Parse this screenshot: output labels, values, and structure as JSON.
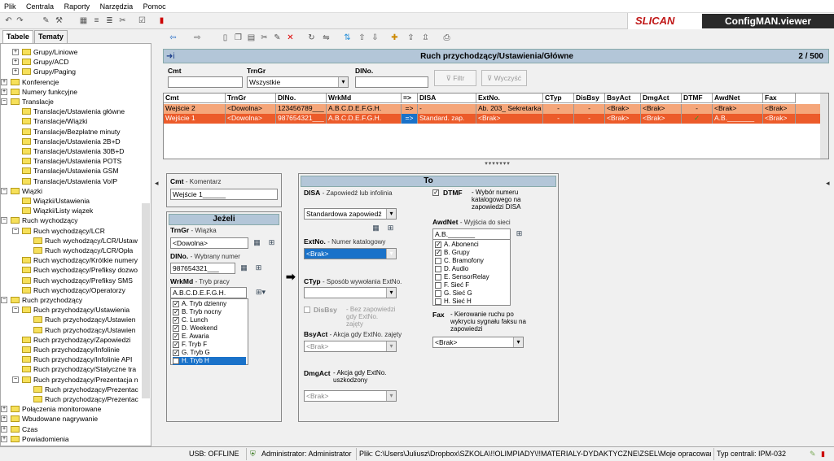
{
  "menu": [
    "Plik",
    "Centrala",
    "Raporty",
    "Narzędzia",
    "Pomoc"
  ],
  "brand": {
    "logo": "SLICAN",
    "app": "ConfigMAN.viewer"
  },
  "left_tabs": [
    "Tabele",
    "Tematy"
  ],
  "tree": [
    {
      "label": "Grupy/Liniowe",
      "level": 2,
      "pm": "+"
    },
    {
      "label": "Grupy/ACD",
      "level": 2,
      "pm": "+"
    },
    {
      "label": "Grupy/Paging",
      "level": 2,
      "pm": "+"
    },
    {
      "label": "Konferencje",
      "level": 1,
      "pm": "+"
    },
    {
      "label": "Numery funkcyjne",
      "level": 1,
      "pm": "+"
    },
    {
      "label": "Translacje",
      "level": 1,
      "pm": "-"
    },
    {
      "label": "Translacje/Ustawienia główne",
      "level": 2,
      "pm": ""
    },
    {
      "label": "Translacje/Wiązki",
      "level": 2,
      "pm": ""
    },
    {
      "label": "Translacje/Bezpłatne minuty",
      "level": 2,
      "pm": ""
    },
    {
      "label": "Translacje/Ustawienia 2B+D",
      "level": 2,
      "pm": ""
    },
    {
      "label": "Translacje/Ustawienia 30B+D",
      "level": 2,
      "pm": ""
    },
    {
      "label": "Translacje/Ustawienia POTS",
      "level": 2,
      "pm": ""
    },
    {
      "label": "Translacje/Ustawienia GSM",
      "level": 2,
      "pm": ""
    },
    {
      "label": "Translacje/Ustawienia VoIP",
      "level": 2,
      "pm": ""
    },
    {
      "label": "Wiązki",
      "level": 1,
      "pm": "-"
    },
    {
      "label": "Wiązki/Ustawienia",
      "level": 2,
      "pm": ""
    },
    {
      "label": "Wiązki/Listy wiązek",
      "level": 2,
      "pm": ""
    },
    {
      "label": "Ruch wychodzący",
      "level": 1,
      "pm": "-"
    },
    {
      "label": "Ruch wychodzący/LCR",
      "level": 2,
      "pm": "-"
    },
    {
      "label": "Ruch wychodzący/LCR/Ustaw",
      "level": 3,
      "pm": ""
    },
    {
      "label": "Ruch wychodzący/LCR/Opła",
      "level": 3,
      "pm": ""
    },
    {
      "label": "Ruch wychodzący/Krótkie numery",
      "level": 2,
      "pm": ""
    },
    {
      "label": "Ruch wychodzący/Prefiksy dozwo",
      "level": 2,
      "pm": ""
    },
    {
      "label": "Ruch wychodzący/Prefiksy SMS",
      "level": 2,
      "pm": ""
    },
    {
      "label": "Ruch wychodzący/Operatorzy",
      "level": 2,
      "pm": ""
    },
    {
      "label": "Ruch przychodzący",
      "level": 1,
      "pm": "-"
    },
    {
      "label": "Ruch przychodzący/Ustawienia",
      "level": 2,
      "pm": "-"
    },
    {
      "label": "Ruch przychodzący/Ustawien",
      "level": 3,
      "pm": ""
    },
    {
      "label": "Ruch przychodzący/Ustawien",
      "level": 3,
      "pm": ""
    },
    {
      "label": "Ruch przychodzący/Zapowiedzi",
      "level": 2,
      "pm": ""
    },
    {
      "label": "Ruch przychodzący/Infolinie",
      "level": 2,
      "pm": ""
    },
    {
      "label": "Ruch przychodzący/Infolinie API",
      "level": 2,
      "pm": ""
    },
    {
      "label": "Ruch przychodzący/Statyczne tra",
      "level": 2,
      "pm": ""
    },
    {
      "label": "Ruch przychodzący/Prezentacja n",
      "level": 2,
      "pm": "-"
    },
    {
      "label": "Ruch przychodzący/Prezentac",
      "level": 3,
      "pm": ""
    },
    {
      "label": "Ruch przychodzący/Prezentac",
      "level": 3,
      "pm": ""
    },
    {
      "label": "Połączenia monitorowane",
      "level": 1,
      "pm": "+"
    },
    {
      "label": "Wbudowane nagrywanie",
      "level": 1,
      "pm": "+"
    },
    {
      "label": "Czas",
      "level": 1,
      "pm": "+"
    },
    {
      "label": "Powiadomienia",
      "level": 1,
      "pm": "+"
    }
  ],
  "header": {
    "title": "Ruch przychodzący/Ustawienia/Główne",
    "count": "2 / 500"
  },
  "filter": {
    "cmt_label": "Cmt",
    "trngr_label": "TrnGr",
    "trngr_value": "Wszystkie",
    "dino_label": "DINo.",
    "filter_btn": "Filtr",
    "clear_btn": "Wyczyść"
  },
  "grid": {
    "columns": [
      "Cmt",
      "TrnGr",
      "DINo.",
      "WrkMd",
      "=>",
      "DISA",
      "ExtNo.",
      "CTyp",
      "DisBsy",
      "BsyAct",
      "DmgAct",
      "DTMF",
      "AwdNet",
      "Fax"
    ],
    "rows": [
      [
        "Wejście 2",
        "<Dowolna>",
        "123456789___",
        "A.B.C.D.E.F.G.H.",
        "=>",
        "-",
        "Ab. 203_ Sekretarka",
        "-",
        "-",
        "<Brak>",
        "<Brak>",
        "-",
        "<Brak>",
        "<Brak>"
      ],
      [
        "Wejście 1",
        "<Dowolna>",
        "987654321___",
        "A.B.C.D.E.F.G.H.",
        "=>",
        "Standard. zap.",
        "<Brak>",
        "-",
        "-",
        "<Brak>",
        "<Brak>",
        "✓",
        "A.B._______",
        "<Brak>"
      ]
    ]
  },
  "form": {
    "cmt": {
      "label": "Cmt",
      "desc": "- Komentarz",
      "value": "Wejście 1______"
    },
    "if_title": "Jeżeli",
    "trngr": {
      "label": "TrnGr",
      "desc": "- Wiązka",
      "value": "<Dowolna>"
    },
    "dino": {
      "label": "DINo.",
      "desc": "- Wybrany numer",
      "value": "987654321___"
    },
    "wrkmd": {
      "label": "WrkMd",
      "desc": "- Tryb pracy",
      "value": "A.B.C.D.E.F.G.H.",
      "items": [
        "A. Tryb dzienny",
        "B. Tryb nocny",
        "C. Lunch",
        "D. Weekend",
        "E. Awaria",
        "F. Tryb F",
        "G. Tryb G",
        "H. Tryb H"
      ]
    },
    "to_title": "To",
    "disa": {
      "label": "DISA",
      "desc": "- Zapowiedź lub infolinia",
      "value": "Standardowa zapowiedź"
    },
    "extno": {
      "label": "ExtNo.",
      "desc": "- Numer katalogowy",
      "value": "<Brak>"
    },
    "ctyp": {
      "label": "CTyp",
      "desc": "- Sposób wywołania ExtNo."
    },
    "disbsy": {
      "label": "DisBsy",
      "desc": "- Bez zapowiedzi gdy ExtNo. zajęty"
    },
    "bsyact": {
      "label": "BsyAct",
      "desc": "- Akcja gdy ExtNo. zajęty",
      "value": "<Brak>"
    },
    "dmgact": {
      "label": "DmgAct",
      "desc": "- Akcja gdy ExtNo. uszkodzony",
      "value": "<Brak>"
    },
    "dtmf": {
      "label": "DTMF",
      "desc": "- Wybór numeru katalogowego na zapowiedzi DISA"
    },
    "awdnet": {
      "label": "AwdNet",
      "desc": "- Wyjścia do sieci",
      "value": "A.B._______",
      "items": [
        "A. Abonenci",
        "B. Grupy",
        "C. Bramofony",
        "D. Audio",
        "E. SensorRelay",
        "F. Sieć F",
        "G. Sieć G",
        "H. Sieć H"
      ],
      "checked": [
        true,
        true,
        false,
        false,
        false,
        false,
        false,
        false
      ]
    },
    "fax": {
      "label": "Fax",
      "desc": "- Kierowanie ruchu po wykryciu sygnału faksu na zapowiedzi",
      "value": "<Brak>"
    }
  },
  "status": {
    "usb": "USB: OFFLINE",
    "user": "Administrator: Administrator",
    "file": "Plik: C:\\Users\\Juliusz\\Dropbox\\SZKOLA\\!!OLIMPIADY\\!!MATERIALY-DYDAKTYCZNE\\ZSEL\\Moje opracowania\\",
    "central": "Typ centrali: IPM-032"
  }
}
